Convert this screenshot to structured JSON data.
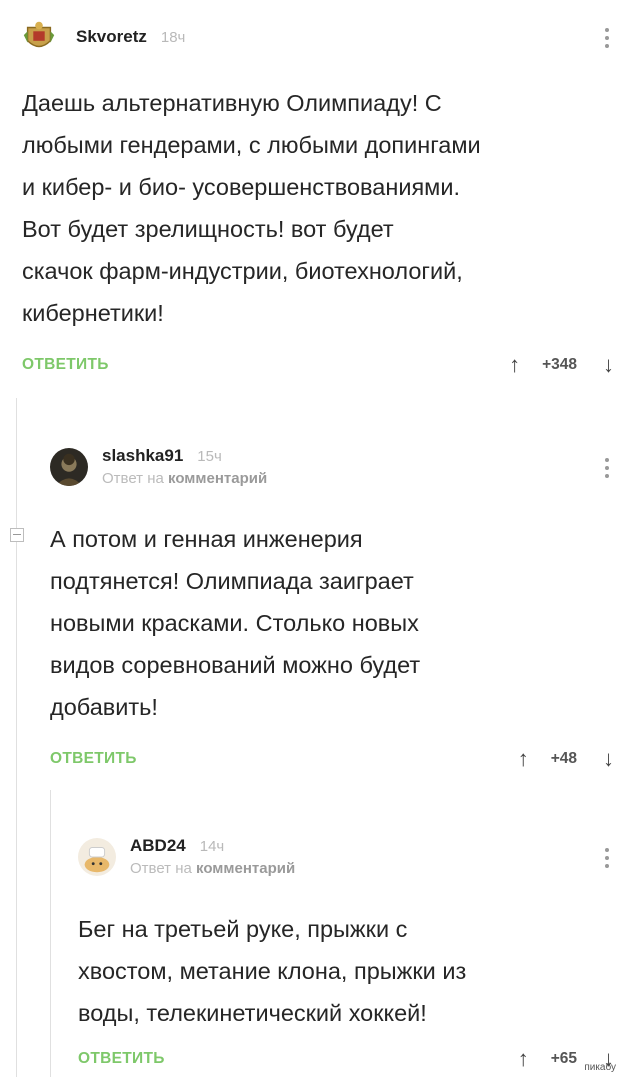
{
  "comments": [
    {
      "username": "Skvoretz",
      "time": "18ч",
      "text": [
        "Даешь альтернативную Олимпиаду! С",
        "любыми гендерами, с любыми допингами",
        "и кибер- и био- усовершенствованиями.",
        "Вот будет зрелищность! вот будет",
        "скачок фарм-индустрии, биотехнологий,",
        "кибернетики!"
      ],
      "reply_label": "ОТВЕТИТЬ",
      "score": "+348"
    },
    {
      "username": "slashka91",
      "time": "15ч",
      "reply_prefix": "Ответ на",
      "reply_target": "комментарий",
      "text": [
        "А потом и генная инженерия",
        "подтянется! Олимпиада заиграет",
        "новыми красками. Столько новых",
        "видов соревнований можно будет",
        "добавить!"
      ],
      "reply_label": "ОТВЕТИТЬ",
      "score": "+48"
    },
    {
      "username": "ABD24",
      "time": "14ч",
      "reply_prefix": "Ответ на",
      "reply_target": "комментарий",
      "text": [
        "Бег на третьей руке, прыжки с",
        "хвостом, метание клона, прыжки из",
        "воды, телекинетический хоккей!"
      ],
      "reply_label": "ОТВЕТИТЬ",
      "score": "+65"
    }
  ],
  "icons": {
    "up": "arrow-up-icon",
    "down": "arrow-down-icon",
    "menu": "more-vertical-icon"
  },
  "colors": {
    "reply_green": "#7ec86a",
    "username": "#222222",
    "muted": "#b9b9b9"
  },
  "watermark": "пикабу"
}
